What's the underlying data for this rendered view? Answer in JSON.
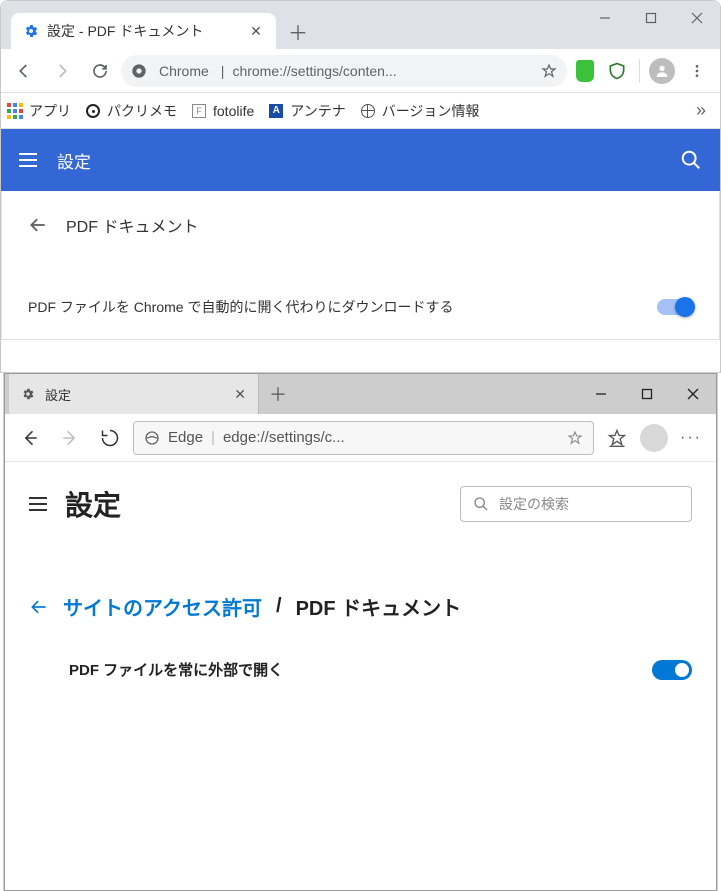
{
  "chrome": {
    "tab": {
      "title": "設定 - PDF ドキュメント"
    },
    "omnibox": {
      "chip": "Chrome",
      "url": "chrome://settings/conten..."
    },
    "bookmarks": {
      "apps": "アプリ",
      "b1": "パクリメモ",
      "b2": "fotolife",
      "b3": "アンテナ",
      "b4": "バージョン情報"
    },
    "settings": {
      "title": "設定",
      "section_title": "PDF ドキュメント",
      "toggle_label": "PDF ファイルを Chrome で自動的に開く代わりにダウンロードする"
    }
  },
  "edge": {
    "tab": {
      "title": "設定"
    },
    "omnibox": {
      "chip": "Edge",
      "url": "edge://settings/c..."
    },
    "settings_title": "設定",
    "search_placeholder": "設定の検索",
    "breadcrumb": {
      "link": "サイトのアクセス許可",
      "sep": "/",
      "current": "PDF ドキュメント"
    },
    "toggle_label": "PDF ファイルを常に外部で開く"
  }
}
